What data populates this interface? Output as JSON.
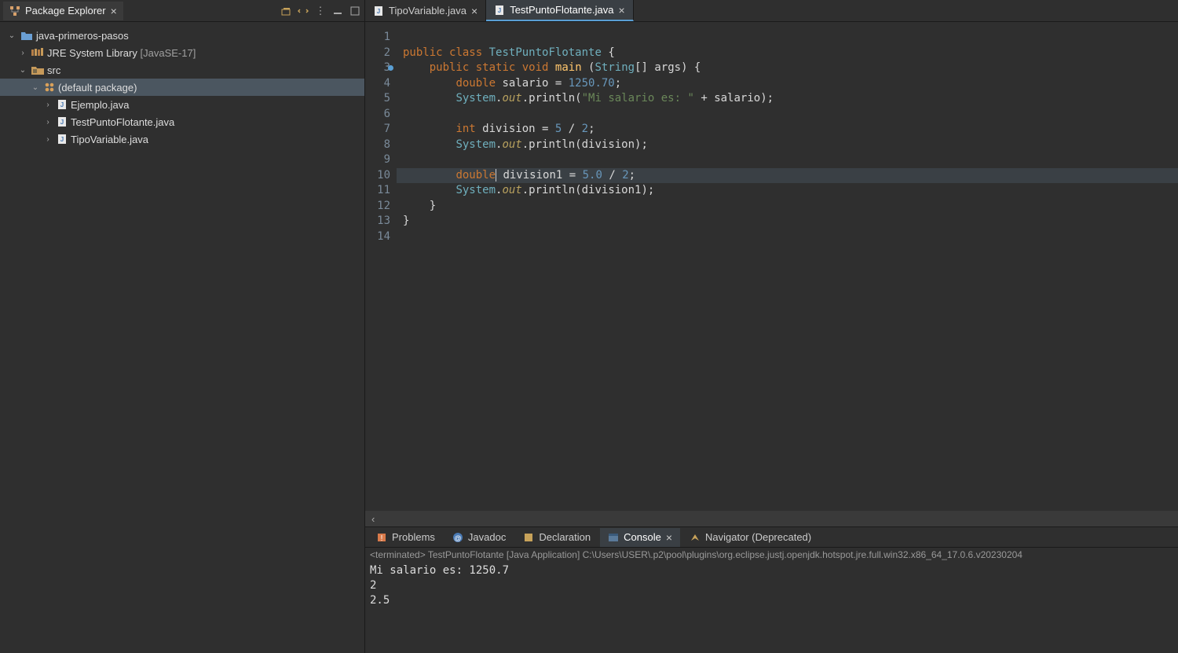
{
  "sidebar": {
    "title": "Package Explorer",
    "project": "java-primeros-pasos",
    "jre": {
      "label": "JRE System Library",
      "version": "[JavaSE-17]"
    },
    "src": "src",
    "pkg": "(default package)",
    "files": [
      {
        "name": "Ejemplo.java"
      },
      {
        "name": "TestPuntoFlotante.java"
      },
      {
        "name": "TipoVariable.java"
      }
    ]
  },
  "editor": {
    "tabs": [
      {
        "label": "TipoVariable.java",
        "active": false
      },
      {
        "label": "TestPuntoFlotante.java",
        "active": true
      }
    ],
    "code": {
      "class_name": "TestPuntoFlotante",
      "lines": [
        {
          "n": 1,
          "text": ""
        },
        {
          "n": 2,
          "tokens": [
            [
              "kw",
              "public"
            ],
            [
              "",
              " "
            ],
            [
              "kw",
              "class"
            ],
            [
              "",
              " "
            ],
            [
              "cls",
              "TestPuntoFlotante"
            ],
            [
              "",
              " {"
            ]
          ]
        },
        {
          "n": 3,
          "mark": true,
          "tokens": [
            [
              "",
              "    "
            ],
            [
              "kw",
              "public"
            ],
            [
              "",
              " "
            ],
            [
              "kw",
              "static"
            ],
            [
              "",
              " "
            ],
            [
              "kw",
              "void"
            ],
            [
              "",
              " "
            ],
            [
              "fn",
              "main"
            ],
            [
              "",
              " ("
            ],
            [
              "cls",
              "String"
            ],
            [
              "",
              "[] args) {"
            ]
          ]
        },
        {
          "n": 4,
          "tokens": [
            [
              "",
              "        "
            ],
            [
              "type",
              "double"
            ],
            [
              "",
              " salario = "
            ],
            [
              "num",
              "1250.70"
            ],
            [
              "",
              ";"
            ]
          ]
        },
        {
          "n": 5,
          "tokens": [
            [
              "",
              "        "
            ],
            [
              "cls",
              "System"
            ],
            [
              "",
              "."
            ],
            [
              "static",
              "out"
            ],
            [
              "",
              ".println("
            ],
            [
              "str",
              "\"Mi salario es: \""
            ],
            [
              "",
              " + salario);"
            ]
          ]
        },
        {
          "n": 6,
          "text": ""
        },
        {
          "n": 7,
          "tokens": [
            [
              "",
              "        "
            ],
            [
              "type",
              "int"
            ],
            [
              "",
              " division = "
            ],
            [
              "num",
              "5"
            ],
            [
              "",
              " / "
            ],
            [
              "num",
              "2"
            ],
            [
              "",
              ";"
            ]
          ]
        },
        {
          "n": 8,
          "tokens": [
            [
              "",
              "        "
            ],
            [
              "cls",
              "System"
            ],
            [
              "",
              "."
            ],
            [
              "static",
              "out"
            ],
            [
              "",
              ".println(division);"
            ]
          ]
        },
        {
          "n": 9,
          "text": ""
        },
        {
          "n": 10,
          "highlight": true,
          "tokens": [
            [
              "",
              "        "
            ],
            [
              "type",
              "double"
            ],
            [
              "caret",
              ""
            ],
            [
              "",
              " division1 = "
            ],
            [
              "num",
              "5.0"
            ],
            [
              "",
              " / "
            ],
            [
              "num",
              "2"
            ],
            [
              "",
              ";"
            ]
          ]
        },
        {
          "n": 11,
          "tokens": [
            [
              "",
              "        "
            ],
            [
              "cls",
              "System"
            ],
            [
              "",
              "."
            ],
            [
              "static",
              "out"
            ],
            [
              "",
              ".println(division1);"
            ]
          ]
        },
        {
          "n": 12,
          "text": "    }"
        },
        {
          "n": 13,
          "text": "}"
        },
        {
          "n": 14,
          "text": ""
        }
      ]
    }
  },
  "bottom": {
    "tabs": [
      {
        "label": "Problems"
      },
      {
        "label": "Javadoc"
      },
      {
        "label": "Declaration"
      },
      {
        "label": "Console",
        "active": true
      },
      {
        "label": "Navigator (Deprecated)"
      }
    ],
    "console": {
      "header": "<terminated> TestPuntoFlotante [Java Application] C:\\Users\\USER\\.p2\\pool\\plugins\\org.eclipse.justj.openjdk.hotspot.jre.full.win32.x86_64_17.0.6.v20230204",
      "lines": [
        "Mi salario es: 1250.7",
        "2",
        "2.5"
      ]
    }
  }
}
